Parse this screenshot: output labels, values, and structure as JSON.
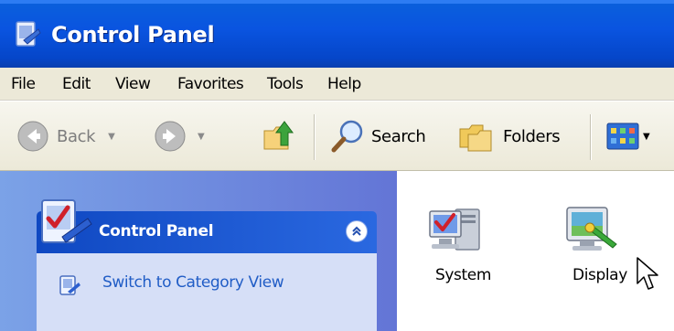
{
  "window": {
    "title": "Control Panel",
    "icon": "control-panel-icon"
  },
  "menu": [
    "File",
    "Edit",
    "View",
    "Favorites",
    "Tools",
    "Help"
  ],
  "toolbar": {
    "back_label": "Back",
    "search_label": "Search",
    "folders_label": "Folders"
  },
  "task_pane": {
    "header": "Control Panel",
    "link": "Switch to Category View"
  },
  "items": [
    {
      "label": "System",
      "icon": "system-icon"
    },
    {
      "label": "Display",
      "icon": "display-icon"
    }
  ],
  "colors": {
    "titlebar": "#0a54e0",
    "menubar": "#ece9d8",
    "taskpane": "#6f8fdf",
    "link": "#215dc6"
  }
}
